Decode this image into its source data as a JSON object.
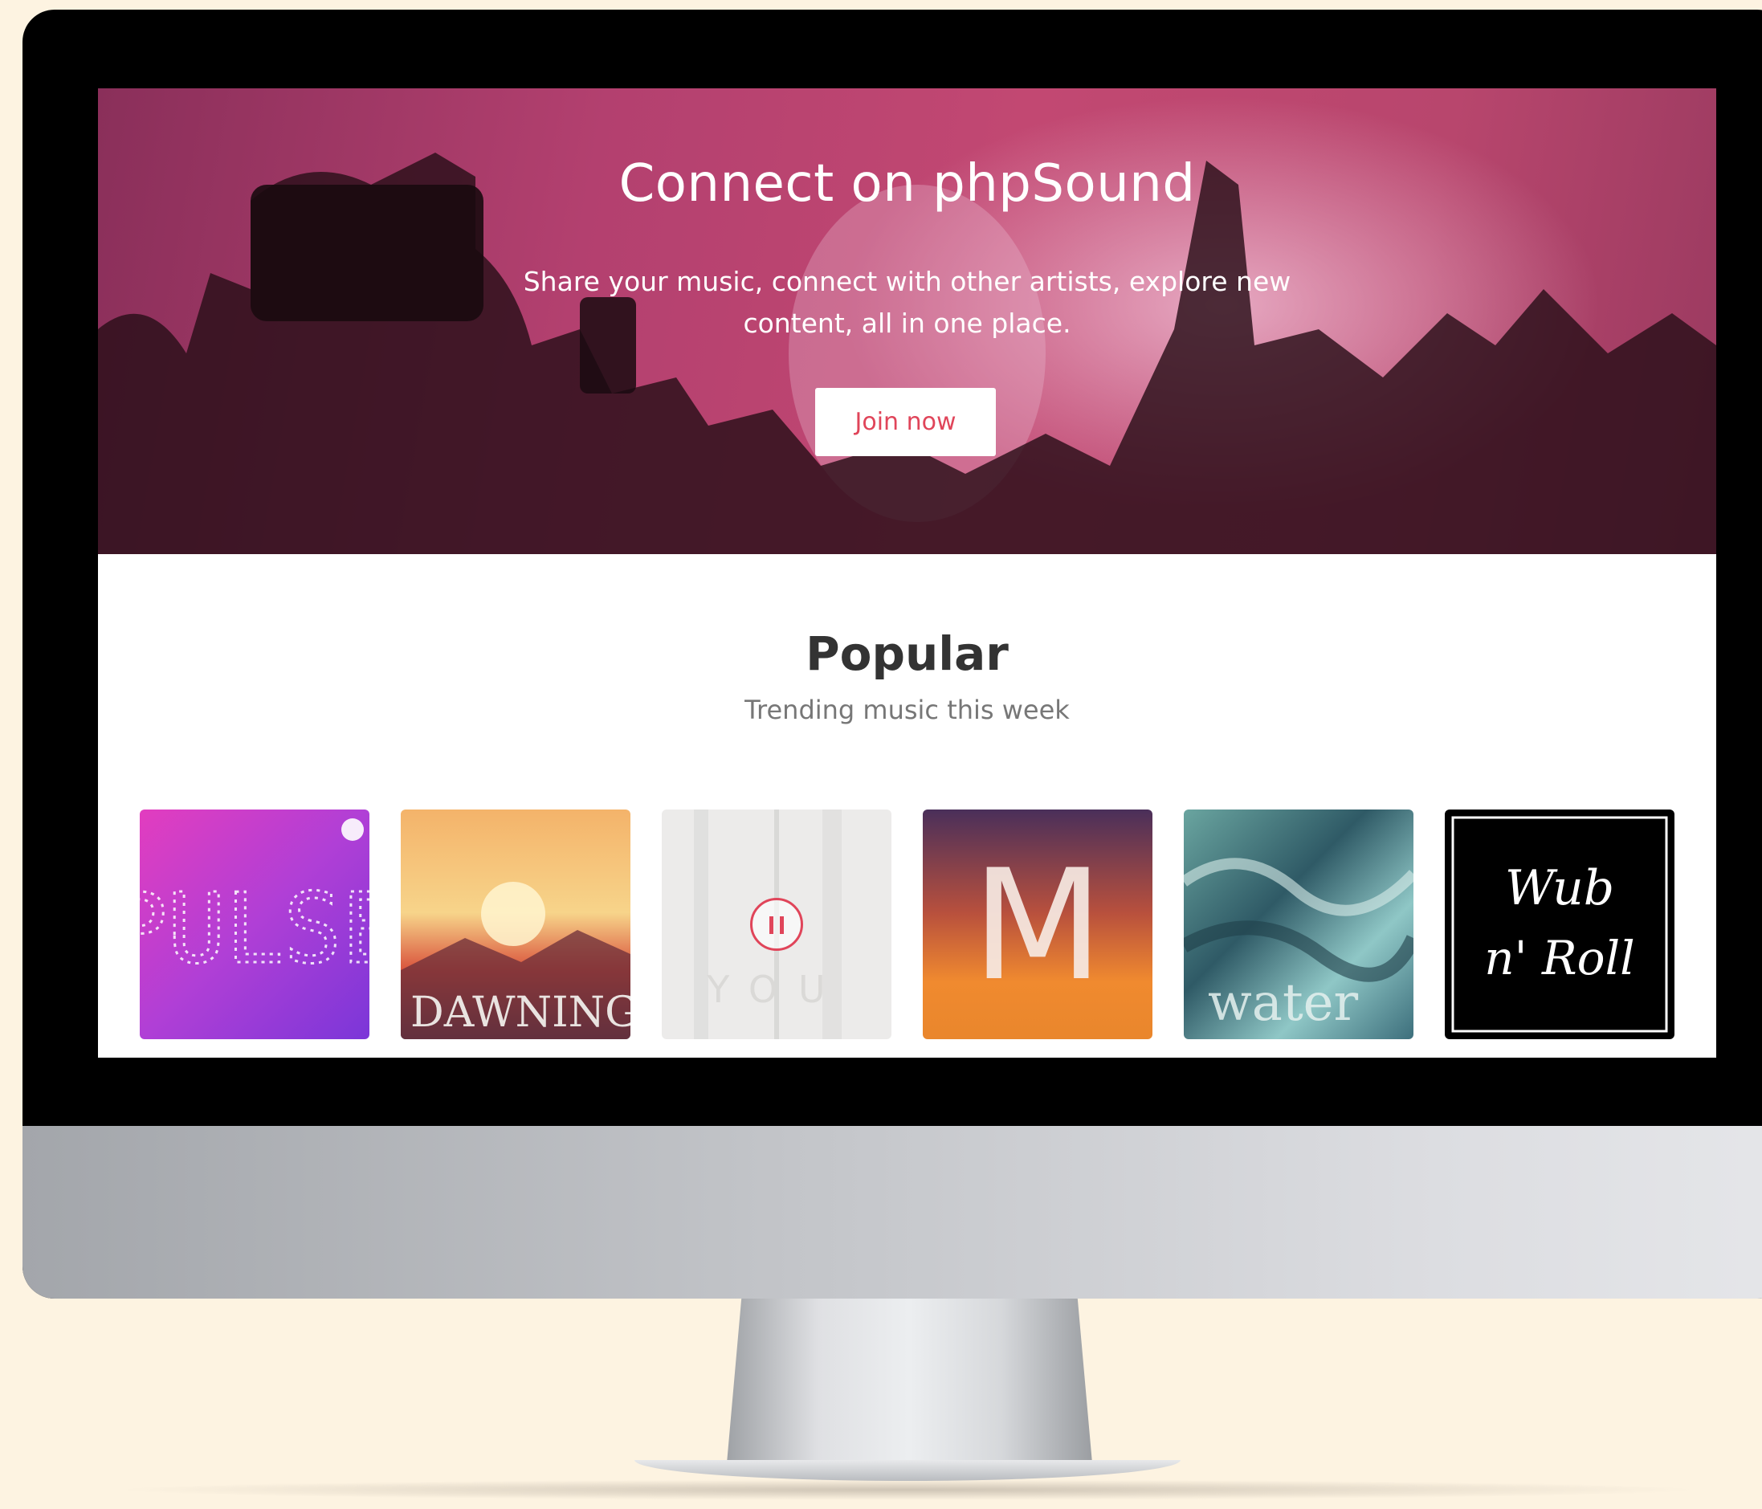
{
  "hero": {
    "title": "Connect on phpSound",
    "subtitle": "Share your music, connect with other artists, explore new content, all in one place.",
    "join_label": "Join now"
  },
  "popular": {
    "title": "Popular",
    "subtitle": "Trending music this week"
  },
  "albums": [
    {
      "art_text": "PULSE",
      "playing": false
    },
    {
      "art_text": "DAWNING",
      "playing": false
    },
    {
      "art_text": "YOU",
      "playing": true
    },
    {
      "art_text": "M",
      "playing": false
    },
    {
      "art_text": "water",
      "playing": false
    },
    {
      "art_text_line1": "Wub",
      "art_text_line2": "n' Roll",
      "playing": false
    }
  ],
  "colors": {
    "accent": "#e0455a",
    "hero_pink": "#c24872",
    "background": "#fdf3e1"
  }
}
